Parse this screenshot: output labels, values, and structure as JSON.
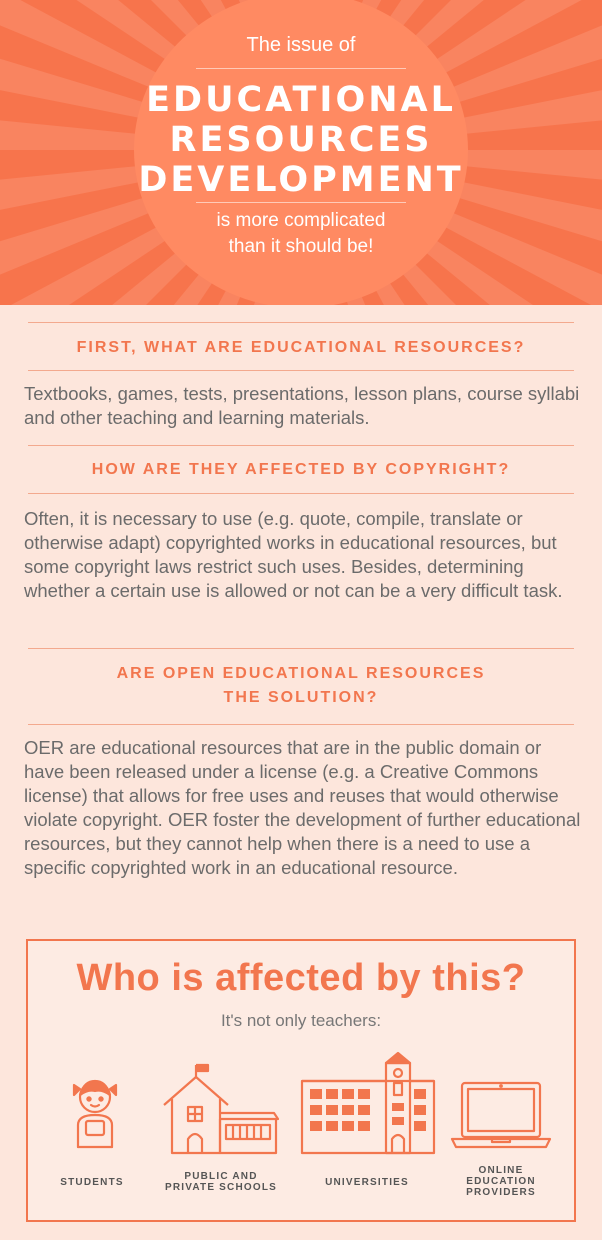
{
  "colors": {
    "accent": "#f2764e",
    "hero_bg": "#f7744c",
    "circle": "#ff8a62",
    "page_bg": "#fde6dc",
    "body_text": "#6b6b6b"
  },
  "hero": {
    "intro": "The issue of",
    "title_lines": [
      "EDUCATIONAL",
      "RESOURCES",
      "DEVELOPMENT"
    ],
    "outro_lines": [
      "is more complicated",
      "than it should be!"
    ]
  },
  "sections": [
    {
      "question_lines": [
        "FIRST, WHAT ARE EDUCATIONAL RESOURCES?"
      ],
      "answer": "Textbooks, games, tests, presentations, lesson plans, course syllabi and other teaching and learning materials."
    },
    {
      "question_lines": [
        "HOW ARE THEY AFFECTED BY COPYRIGHT?"
      ],
      "answer": "Often, it is necessary to use (e.g. quote, compile, translate or otherwise adapt) copyrighted works in educational resources, but some copyright laws restrict such uses. Besides, determining whether a certain use is allowed or not can be a very difficult task."
    },
    {
      "question_lines": [
        "ARE OPEN EDUCATIONAL RESOURCES",
        "THE SOLUTION?"
      ],
      "answer": "OER are educational resources that are in the public domain or have been released under a license (e.g. a Creative Commons license) that allows for free uses and reuses that would otherwise violate copyright. OER foster the development of further educational resources, but they cannot help when there is a need to use a specific copyrighted work in an educational resource."
    }
  ],
  "affected": {
    "title": "Who is affected by this?",
    "subtitle": "It's not only teachers:",
    "groups": [
      {
        "icon": "student-icon",
        "label_lines": [
          "STUDENTS"
        ]
      },
      {
        "icon": "school-building-icon",
        "label_lines": [
          "PUBLIC AND",
          "PRIVATE SCHOOLS"
        ]
      },
      {
        "icon": "university-building-icon",
        "label_lines": [
          "UNIVERSITIES"
        ]
      },
      {
        "icon": "laptop-icon",
        "label_lines": [
          "ONLINE",
          "EDUCATION",
          "PROVIDERS"
        ]
      }
    ]
  }
}
